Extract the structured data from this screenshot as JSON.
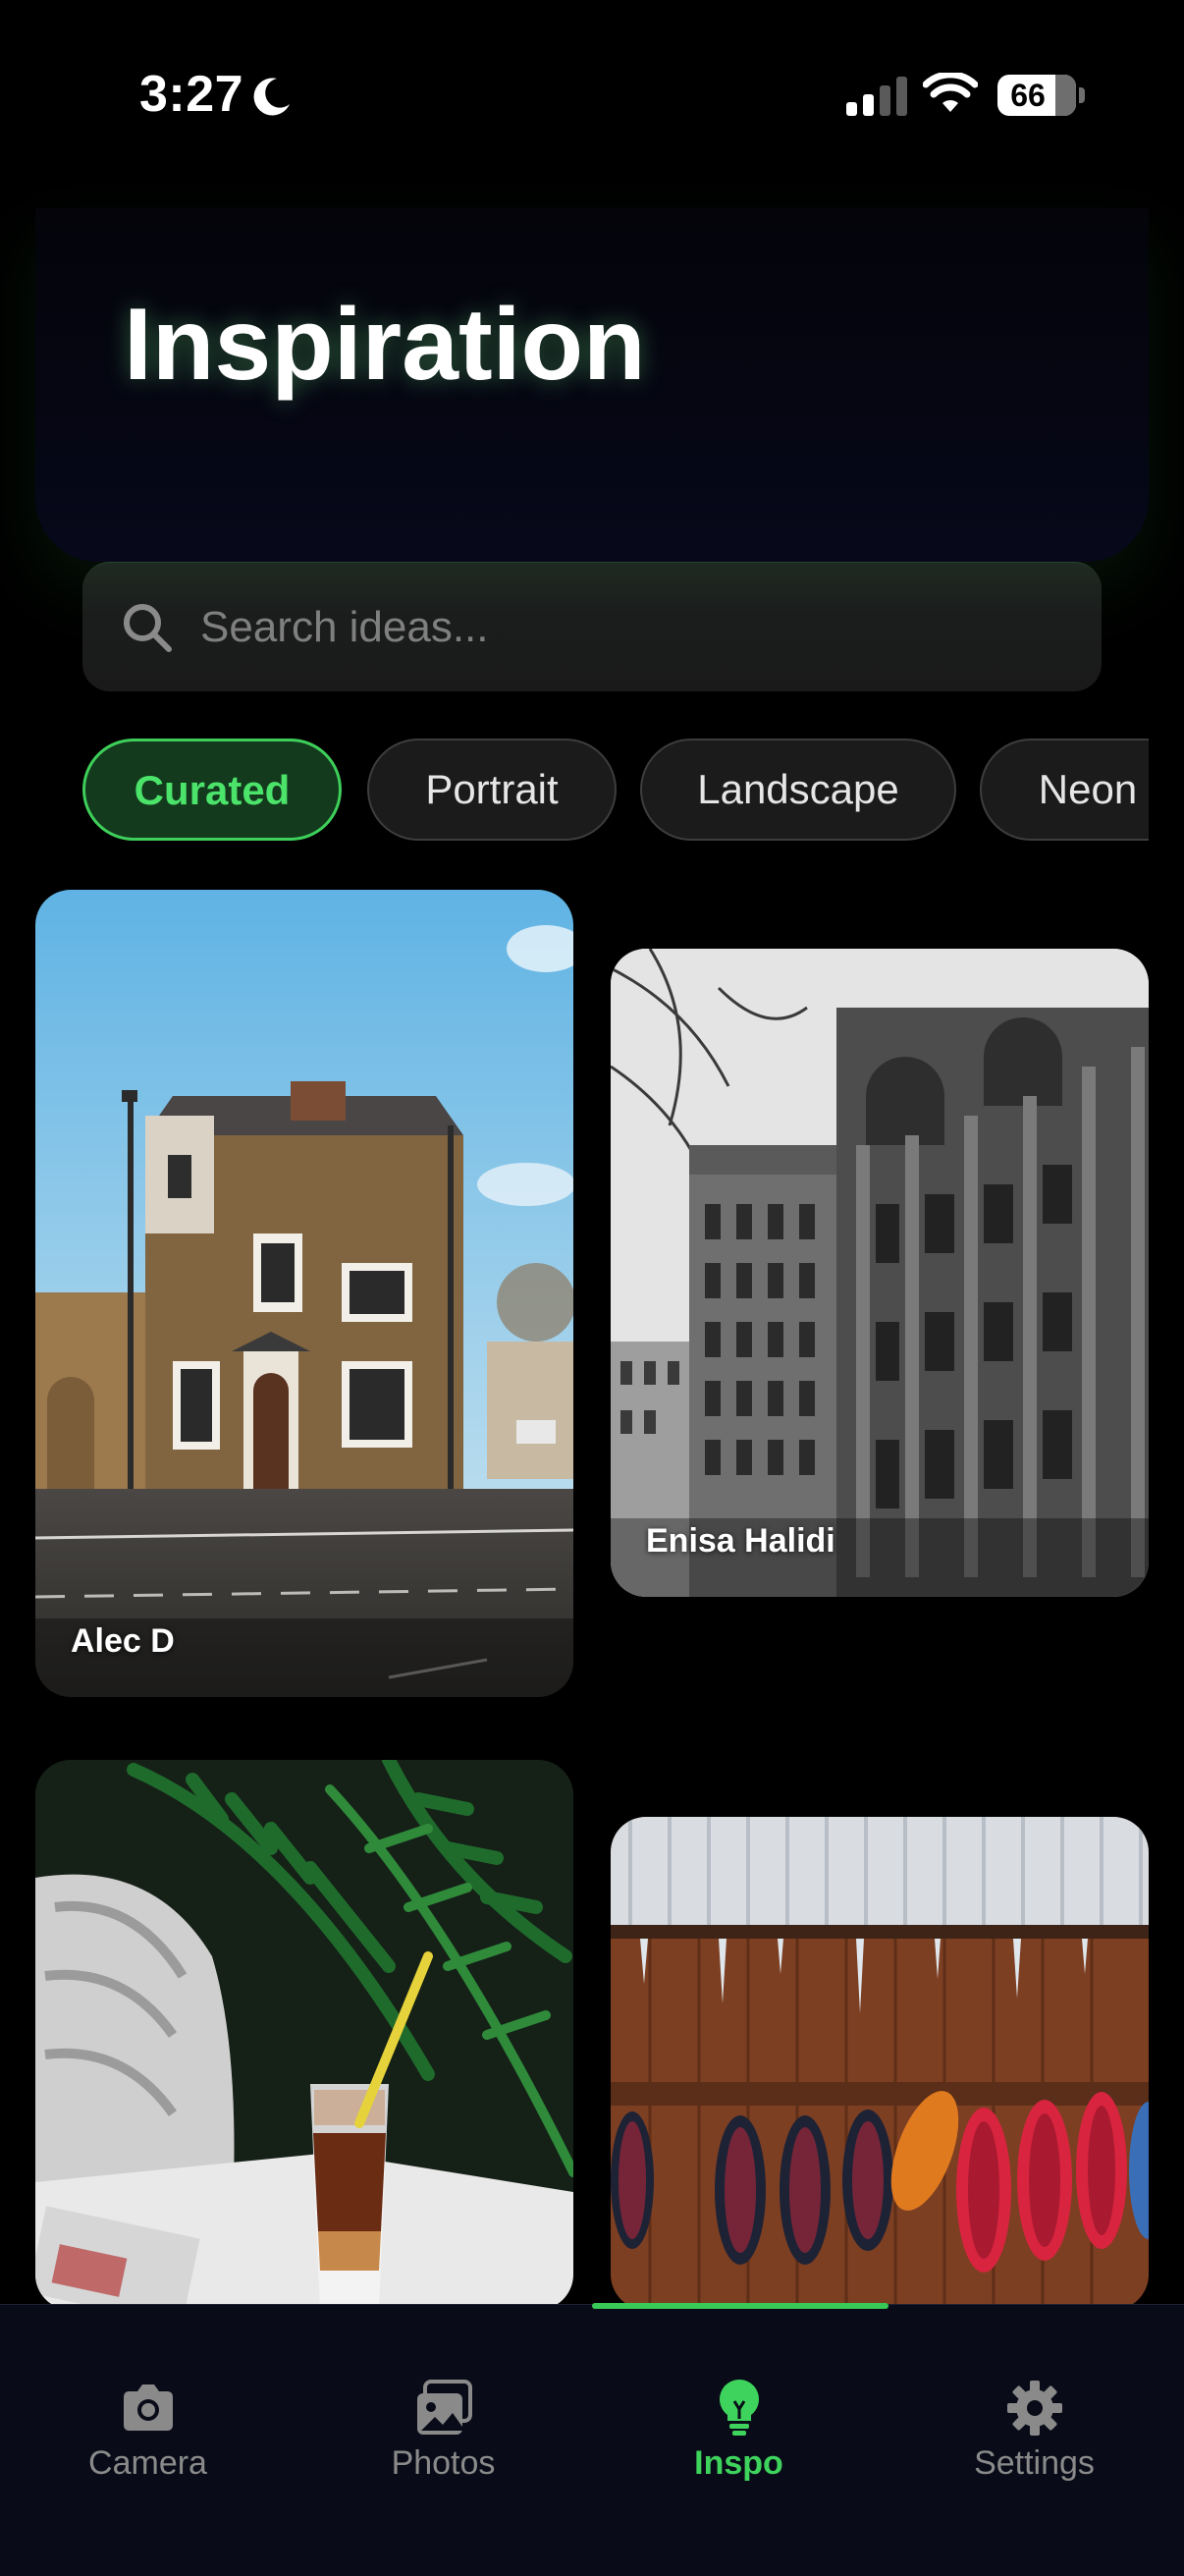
{
  "status_bar": {
    "time": "3:27",
    "battery": "66",
    "battery_level": 0.66
  },
  "header": {
    "title": "Inspiration"
  },
  "search": {
    "placeholder": "Search ideas..."
  },
  "chips": [
    {
      "label": "Curated",
      "active": true
    },
    {
      "label": "Portrait",
      "active": false
    },
    {
      "label": "Landscape",
      "active": false
    },
    {
      "label": "Neon",
      "active": false
    }
  ],
  "photos": [
    {
      "credit": "Alec D",
      "subject": "brick house on street corner"
    },
    {
      "credit": "Enisa Halidi",
      "subject": "black and white ornate buildings"
    },
    {
      "credit": "",
      "subject": "iced coffee with palm leaves"
    },
    {
      "credit": "",
      "subject": "snowshoes on wooden wall"
    }
  ],
  "tabs": [
    {
      "label": "Camera",
      "icon": "camera-icon",
      "active": false
    },
    {
      "label": "Photos",
      "icon": "photos-icon",
      "active": false
    },
    {
      "label": "Inspo",
      "icon": "lightbulb-icon",
      "active": true
    },
    {
      "label": "Settings",
      "icon": "gear-icon",
      "active": false
    }
  ],
  "colors": {
    "accent": "#3ecf5a",
    "background": "#000000",
    "tab_bar": "#090c18"
  }
}
